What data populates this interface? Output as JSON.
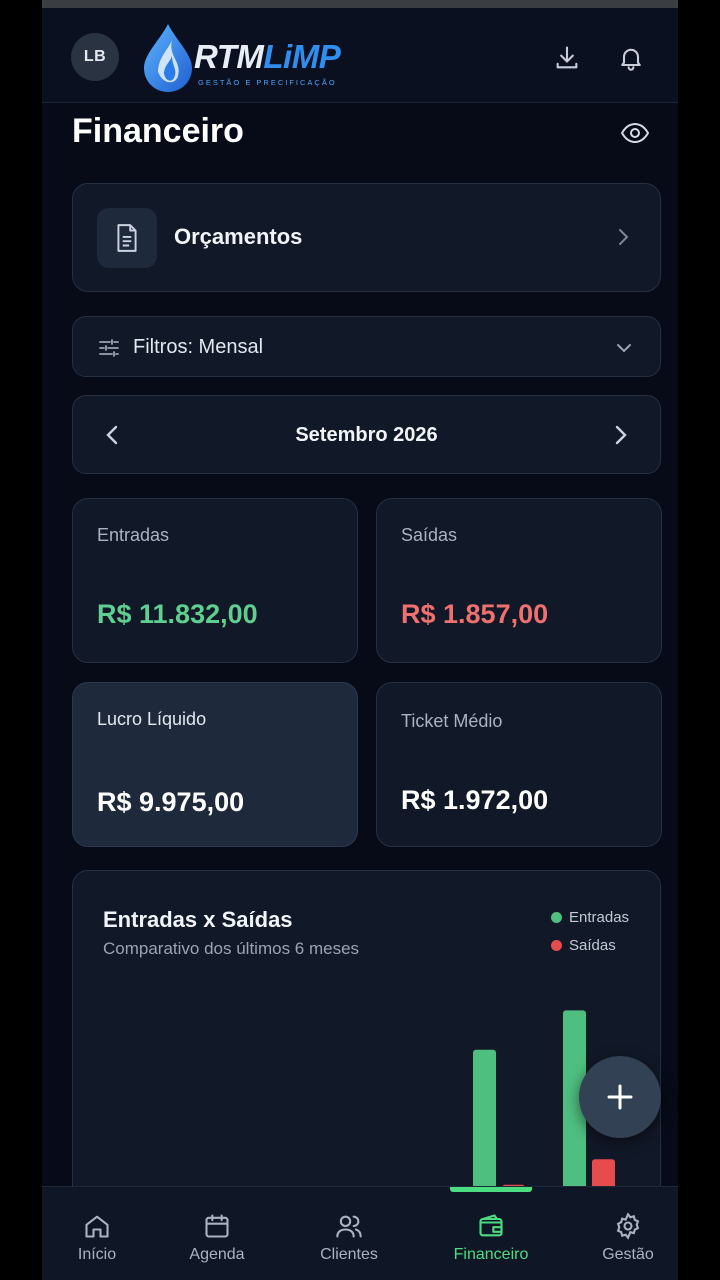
{
  "header": {
    "avatar_initials": "LB",
    "logo_main": "RTM",
    "logo_accent": "LiMP",
    "logo_tagline": "GESTÃO E PRECIFICAÇÃO",
    "icons": [
      "download-icon",
      "bell-icon"
    ]
  },
  "page": {
    "title": "Financeiro"
  },
  "orcamentos": {
    "label": "Orçamentos"
  },
  "filter": {
    "label": "Filtros: Mensal"
  },
  "month": {
    "label": "Setembro 2026"
  },
  "stats": {
    "entradas": {
      "label": "Entradas",
      "value": "R$ 11.832,00",
      "color": "#5fcf8f"
    },
    "saidas": {
      "label": "Saídas",
      "value": "R$ 1.857,00",
      "color": "#f07070"
    },
    "lucro": {
      "label": "Lucro Líquido",
      "value": "R$ 9.975,00",
      "color": "#ffffff"
    },
    "ticket": {
      "label": "Ticket Médio",
      "value": "R$ 1.972,00",
      "color": "#ffffff"
    }
  },
  "chart": {
    "title": "Entradas x Saídas",
    "subtitle": "Comparativo dos últimos 6 meses",
    "legend": [
      {
        "name": "Entradas",
        "color": "#4fbf7f"
      },
      {
        "name": "Saídas",
        "color": "#e74c4c"
      }
    ]
  },
  "chart_data": {
    "type": "bar",
    "series": [
      {
        "name": "Entradas",
        "color": "#4fbf7f",
        "values": [
          0,
          0,
          0,
          0,
          9200,
          11832
        ]
      },
      {
        "name": "Saídas",
        "color": "#e74c4c",
        "values": [
          0,
          0,
          0,
          0,
          150,
          1857
        ]
      }
    ],
    "ylim": [
      0,
      13000
    ],
    "title": "Entradas x Saídas"
  },
  "bottom_nav": [
    {
      "label": "Início",
      "icon": "home-icon",
      "active": false
    },
    {
      "label": "Agenda",
      "icon": "calendar-icon",
      "active": false
    },
    {
      "label": "Clientes",
      "icon": "users-icon",
      "active": false
    },
    {
      "label": "Financeiro",
      "icon": "wallet-icon",
      "active": true
    },
    {
      "label": "Gestão",
      "icon": "gear-icon",
      "active": false
    }
  ]
}
